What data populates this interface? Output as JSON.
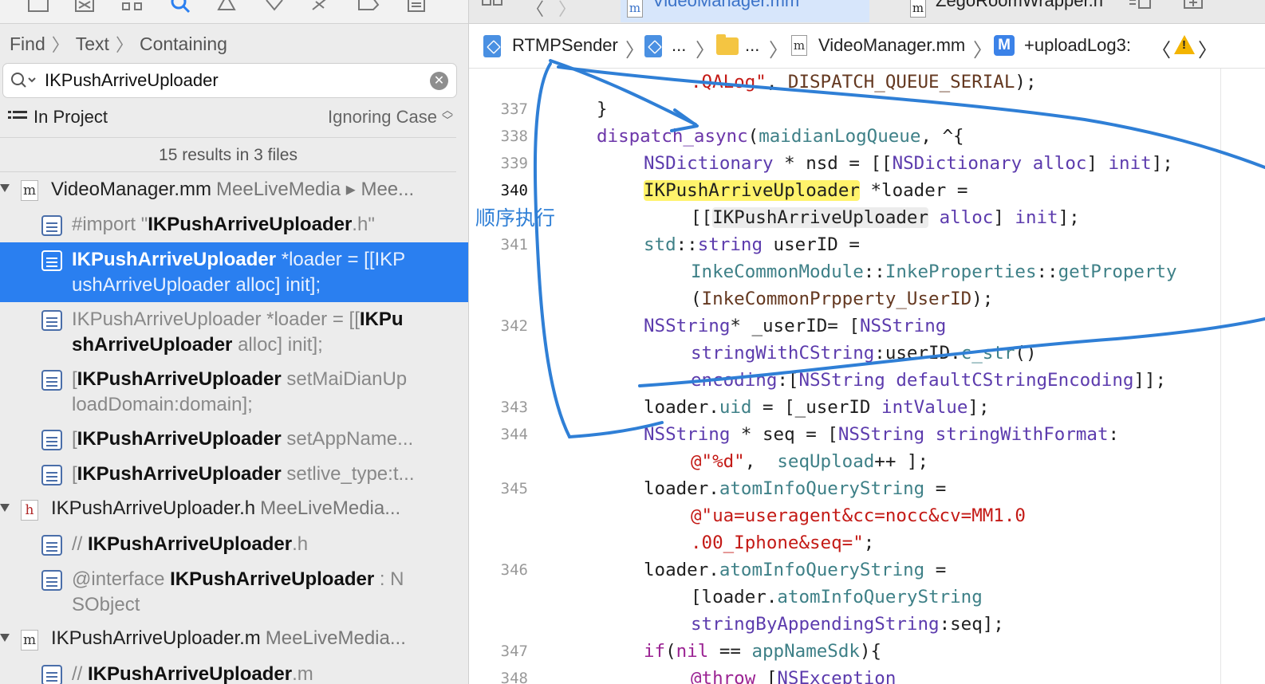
{
  "find_navigator": {
    "path": [
      "Find",
      "Text",
      "Containing"
    ],
    "query": "IKPushArriveUploader",
    "scope": "In Project",
    "case": "Ignoring Case",
    "results_summary": "15 results in 3 files",
    "files": [
      {
        "icon": "m",
        "name": "VideoManager.mm",
        "path": "MeeLiveMedia ▸ Mee...",
        "matches": [
          {
            "parts": [
              [
                "n",
                "#import \""
              ],
              [
                "b",
                "IKPushArriveUploader"
              ],
              [
                "n",
                ".h\""
              ]
            ]
          },
          {
            "parts": [
              [
                "b",
                "IKPushArriveUploader"
              ],
              [
                "n",
                " *loader = [[IKP"
              ]
            ],
            "line2": [
              [
                "n",
                "ushArriveUploader alloc] init];"
              ]
            ],
            "selected": true
          },
          {
            "parts": [
              [
                "n",
                "IKPushArriveUploader *loader = [["
              ],
              [
                "b",
                "IKPu"
              ]
            ],
            "line2": [
              [
                "b",
                "shArriveUploader"
              ],
              [
                "n",
                " alloc] init];"
              ]
            ]
          },
          {
            "parts": [
              [
                "n",
                "["
              ],
              [
                "b",
                "IKPushArriveUploader"
              ],
              [
                "n",
                " setMaiDianUp"
              ]
            ],
            "line2": [
              [
                "n",
                "loadDomain:domain];"
              ]
            ]
          },
          {
            "parts": [
              [
                "n",
                "["
              ],
              [
                "b",
                "IKPushArriveUploader"
              ],
              [
                "n",
                " setAppName..."
              ]
            ]
          },
          {
            "parts": [
              [
                "n",
                "["
              ],
              [
                "b",
                "IKPushArriveUploader"
              ],
              [
                "n",
                " setlive_type:t..."
              ]
            ]
          }
        ]
      },
      {
        "icon": "h",
        "name": "IKPushArriveUploader.h",
        "path": "MeeLiveMedia...",
        "matches": [
          {
            "parts": [
              [
                "n",
                "//  "
              ],
              [
                "b",
                "IKPushArriveUploader"
              ],
              [
                "n",
                ".h"
              ]
            ]
          },
          {
            "parts": [
              [
                "n",
                "@interface "
              ],
              [
                "b",
                "IKPushArriveUploader"
              ],
              [
                "n",
                " : N"
              ]
            ],
            "line2": [
              [
                "n",
                "SObject"
              ]
            ]
          }
        ]
      },
      {
        "icon": "m",
        "name": "IKPushArriveUploader.m",
        "path": "MeeLiveMedia...",
        "matches": [
          {
            "parts": [
              [
                "n",
                "//  "
              ],
              [
                "b",
                "IKPushArriveUploader"
              ],
              [
                "n",
                ".m"
              ]
            ]
          }
        ]
      }
    ]
  },
  "editor": {
    "tabs": [
      {
        "label": "VideoManager.mm",
        "active": true
      },
      {
        "label": "ZegoRoomWrapper.h",
        "active": false
      }
    ],
    "jumpbar": {
      "project": "RTMPSender",
      "group1": "...",
      "group2": "...",
      "file": "VideoManager.mm",
      "method_badge": "M",
      "method": "+uploadLog3:"
    },
    "line_numbers": [
      "337",
      "338",
      "339",
      "340",
      "341",
      "342",
      "343",
      "344",
      "345",
      "346",
      "347",
      "348"
    ],
    "current_line": "340",
    "annotation_text": "顺序执行"
  },
  "colors": {
    "selection": "#2a7ff0",
    "keyword": "#9b2393",
    "type": "#5c3bad",
    "string": "#c41a16",
    "highlight": "#fff36b",
    "annotation": "#2f7fd6"
  }
}
